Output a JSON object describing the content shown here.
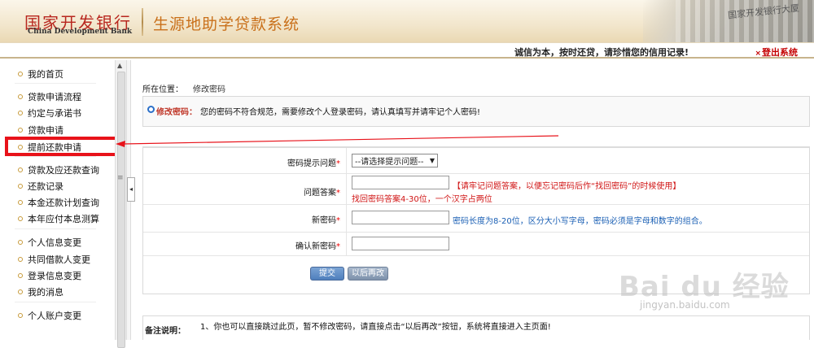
{
  "header": {
    "logo_cn": "国家开发银行",
    "logo_en": "China Development Bank",
    "system_title": "生源地助学贷款系统",
    "building_text": "国家开发银行大厦"
  },
  "topbar": {
    "slogan": "诚信为本，按时还贷，请珍惜您的信用记录!",
    "logout_icon": "×",
    "logout": "登出系统"
  },
  "sidebar": {
    "items": [
      {
        "label": "我的首页"
      },
      {
        "label": "贷款申请流程"
      },
      {
        "label": "约定与承诺书"
      },
      {
        "label": "贷款申请"
      },
      {
        "label": "提前还款申请"
      },
      {
        "label": "贷款及应还款查询"
      },
      {
        "label": "还款记录"
      },
      {
        "label": "本金还款计划查询"
      },
      {
        "label": "本年应付本息测算"
      },
      {
        "label": "个人信息变更"
      },
      {
        "label": "共同借款人变更"
      },
      {
        "label": "登录信息变更"
      },
      {
        "label": "我的消息"
      },
      {
        "label": "个人账户变更"
      }
    ]
  },
  "main": {
    "location_label": "所在位置：",
    "location_value": "修改密码",
    "notice_label": "修改密码：",
    "notice_text": "您的密码不符合规范，需要修改个人登录密码，请认真填写并请牢记个人密码!",
    "form": {
      "question_label": "密码提示问题",
      "question_selected": "--请选择提示问题--",
      "answer_label": "问题答案",
      "answer_value": "",
      "answer_hint1": "【请牢记问题答案，以便忘记密码后作“找回密码”的时候使用】",
      "answer_hint2": "找回密码答案4-30位，一个汉字占两位",
      "newpwd_label": "新密码",
      "newpwd_value": "",
      "newpwd_hint": "密码长度为8-20位，区分大小写字母，密码必须是字母和数字的组合。",
      "confirm_label": "确认新密码",
      "confirm_value": "",
      "required_mark": "*"
    },
    "buttons": {
      "submit": "提交",
      "later": "以后再改"
    },
    "remark_label": "备注说明：",
    "remark_text": "1、你也可以直接跳过此页，暂不修改密码，请直接点击“以后再改”按钮，系统将直接进入主页面!"
  },
  "watermark": {
    "main": "Bai du 经验",
    "sub": "jingyan.baidu.com"
  },
  "colors": {
    "highlight_box": "#e8121a",
    "brand_red": "#b8271f",
    "title_orange": "#c9701a",
    "hint_red": "#d01515",
    "hint_blue": "#1a5fb4",
    "button_blue": "#4f7fbd"
  }
}
